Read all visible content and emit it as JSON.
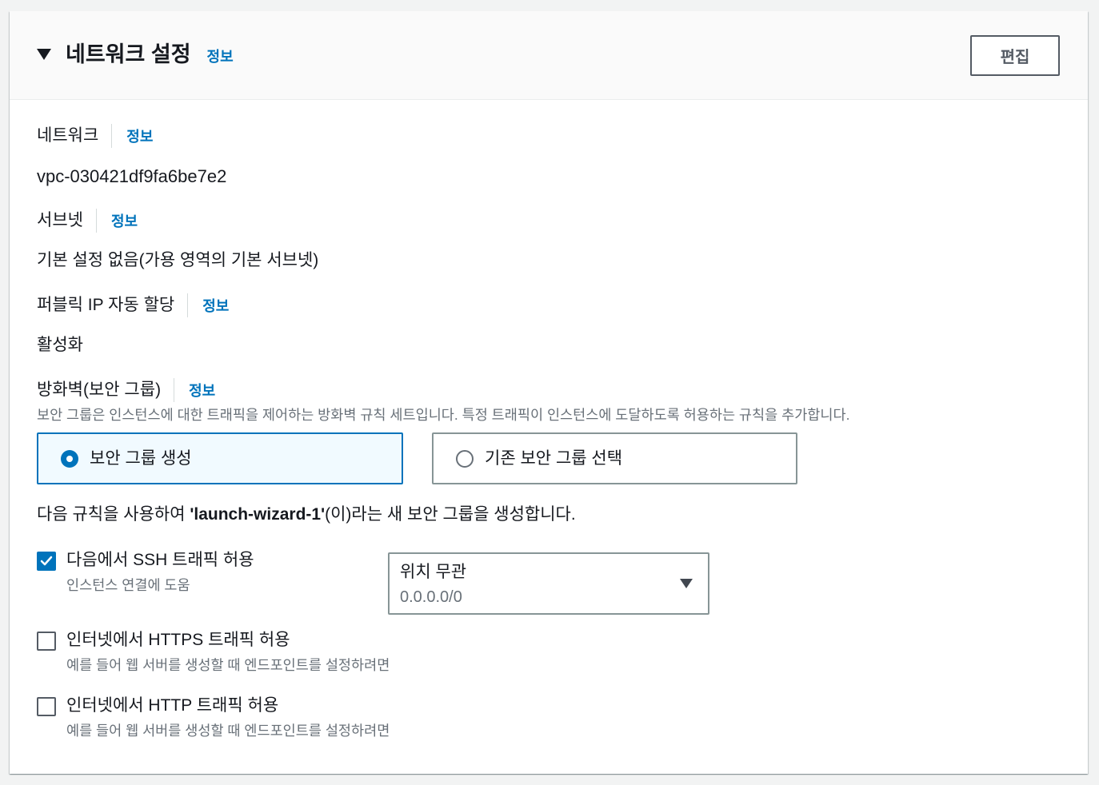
{
  "section": {
    "title": "네트워크 설정",
    "info_label": "정보",
    "edit_button": "편집"
  },
  "fields": {
    "network": {
      "label": "네트워크",
      "info": "정보",
      "value": "vpc-030421df9fa6be7e2"
    },
    "subnet": {
      "label": "서브넷",
      "info": "정보",
      "value": "기본 설정 없음(가용 영역의 기본 서브넷)"
    },
    "public_ip": {
      "label": "퍼블릭 IP 자동 할당",
      "info": "정보",
      "value": "활성화"
    },
    "firewall": {
      "label": "방화벽(보안 그룹)",
      "info": "정보",
      "description": "보안 그룹은 인스턴스에 대한 트래픽을 제어하는 방화벽 규칙 세트입니다. 특정 트래픽이 인스턴스에 도달하도록 허용하는 규칙을 추가합니다."
    }
  },
  "security_group_options": [
    {
      "label": "보안 그룹 생성",
      "selected": true
    },
    {
      "label": "기존 보안 그룹 선택",
      "selected": false
    }
  ],
  "rules_intro": {
    "prefix": "다음 규칙을 사용하여 ",
    "group_name": "'launch-wizard-1'",
    "suffix": "(이)라는 새 보안 그룹을 생성합니다."
  },
  "rules": [
    {
      "label": "다음에서 SSH 트래픽 허용",
      "description": "인스턴스 연결에 도움",
      "checked": true
    },
    {
      "label": "인터넷에서 HTTPS 트래픽 허용",
      "description": "예를 들어 웹 서버를 생성할 때 엔드포인트를 설정하려면",
      "checked": false
    },
    {
      "label": "인터넷에서 HTTP 트래픽 허용",
      "description": "예를 들어 웹 서버를 생성할 때 엔드포인트를 설정하려면",
      "checked": false
    }
  ],
  "ssh_source": {
    "selected_label": "위치 무관",
    "selected_value": "0.0.0.0/0"
  },
  "icons": {
    "section_toggle": "caret-down-icon",
    "select_toggle": "caret-down-icon",
    "checkbox_mark": "check-icon",
    "option_radio": "radio-icon"
  },
  "colors": {
    "accent": "#0073bb",
    "text": "#16191f",
    "secondary_text": "#687078",
    "selected_tile_bg": "#f1faff"
  }
}
